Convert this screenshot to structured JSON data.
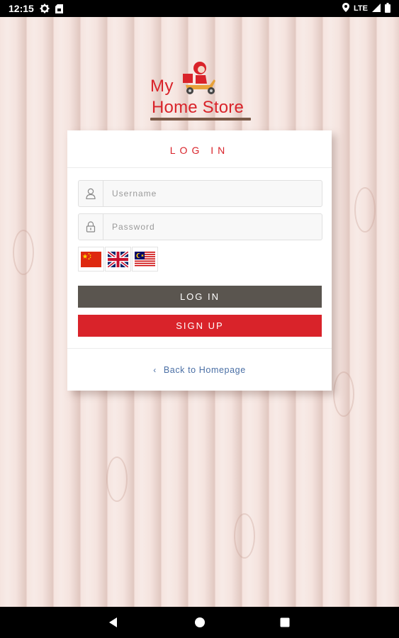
{
  "status_bar": {
    "time": "12:15",
    "network": "LTE",
    "icons": [
      "gear-icon",
      "sim-card-icon",
      "location-icon",
      "signal-icon",
      "battery-icon"
    ]
  },
  "logo": {
    "line1": "My",
    "line2": "Home Store"
  },
  "login_card": {
    "title": "LOG IN",
    "username_placeholder": "Username",
    "password_placeholder": "Password",
    "languages": [
      "chinese-flag-icon",
      "uk-flag-icon",
      "malaysia-flag-icon"
    ],
    "login_label": "LOG IN",
    "signup_label": "SIGN UP",
    "back_link": "Back to Homepage"
  },
  "colors": {
    "accent_red": "#d9232a",
    "login_button": "#5a554f",
    "link_blue": "#4a6fa5"
  },
  "nav_bar": {
    "icons": [
      "back-icon",
      "home-icon",
      "recent-apps-icon"
    ]
  }
}
